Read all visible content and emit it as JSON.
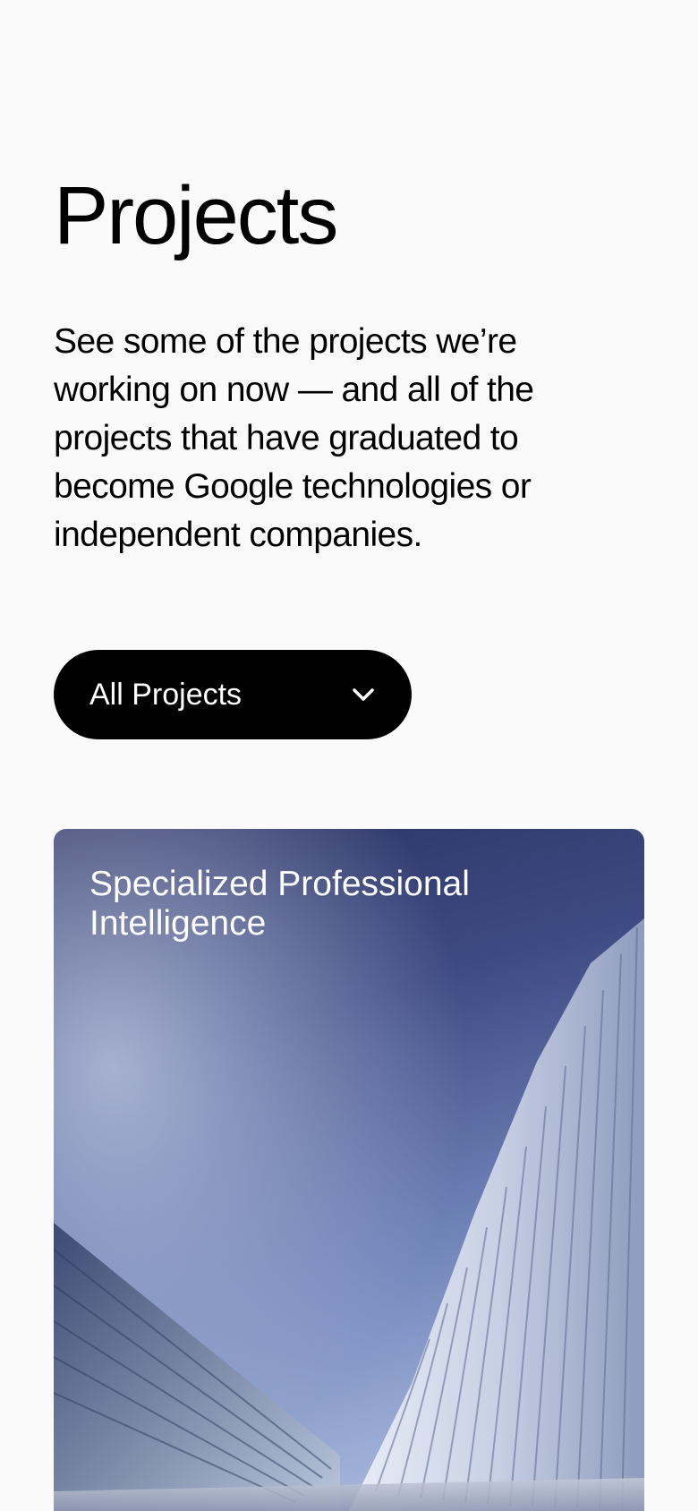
{
  "page": {
    "title": "Projects",
    "intro": "See some of the projects we’re working on now — and all of the projects that have graduated to become Google technologies or independent companies."
  },
  "filter": {
    "label": "All Projects",
    "icon": "chevron-down-icon"
  },
  "projects": [
    {
      "title": "Specialized Professional Intelligence"
    }
  ],
  "colors": {
    "background": "#fafafa",
    "text": "#000000",
    "button_bg": "#000000",
    "button_text": "#ffffff",
    "card_sky_top": "#2a3160",
    "card_sky_bottom": "#b8c4e0"
  }
}
